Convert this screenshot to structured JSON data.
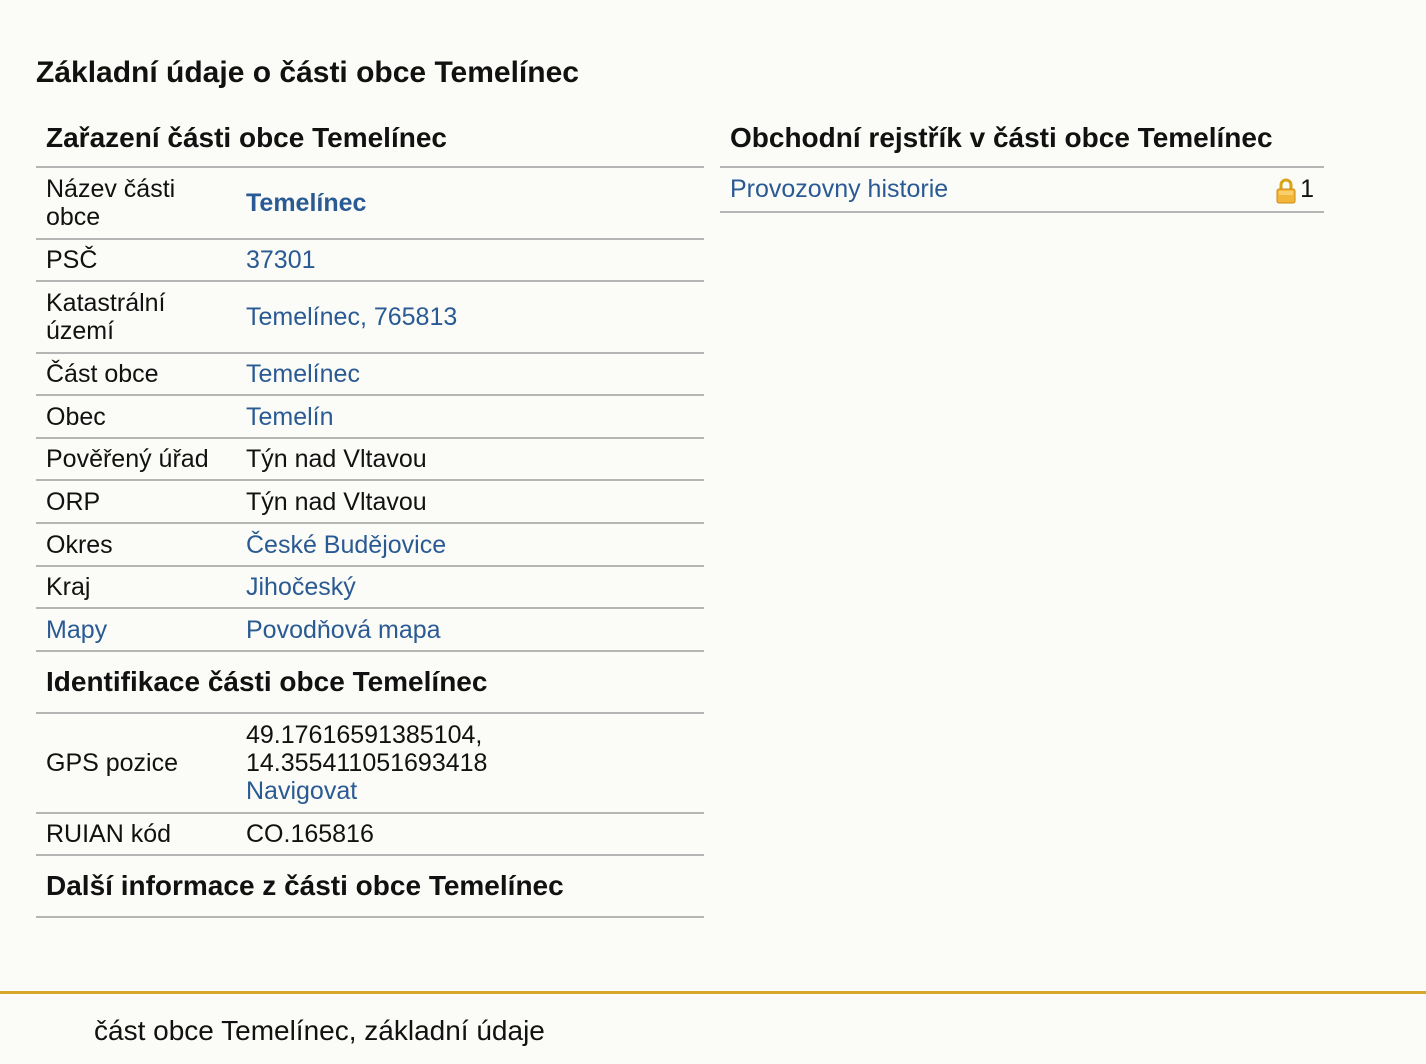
{
  "page": {
    "title": "Základní údaje o části obce Temelínec"
  },
  "zarazeni": {
    "heading": "Zařazení části obce Temelínec",
    "rows": [
      {
        "label": "Název části obce",
        "value": "Temelínec"
      },
      {
        "label": "PSČ",
        "value": "37301"
      },
      {
        "label": "Katastrální území",
        "value": "Temelínec, 765813"
      },
      {
        "label": "Část obce",
        "value": "Temelínec"
      },
      {
        "label": "Obec",
        "value": "Temelín"
      },
      {
        "label": "Pověřený úřad",
        "value": "Týn nad Vltavou"
      },
      {
        "label": "ORP",
        "value": "Týn nad Vltavou"
      },
      {
        "label": "Okres",
        "value": "České Budějovice"
      },
      {
        "label": "Kraj",
        "value": "Jihočeský"
      },
      {
        "label": "Mapy",
        "value": "Povodňová mapa"
      }
    ]
  },
  "identifikace": {
    "heading": "Identifikace části obce Temelínec",
    "gps_label": "GPS pozice",
    "gps_lat": "49.17616591385104,",
    "gps_lon": "14.355411051693418",
    "navigate_label": "Navigovat",
    "ruian_label": "RUIAN kód",
    "ruian_value": "CO.165816"
  },
  "dalsi": {
    "heading": "Další informace z části obce Temelínec"
  },
  "rejstrik": {
    "heading": "Obchodní rejstřík v části obce Temelínec",
    "item_label": "Provozovny historie",
    "item_count": "1",
    "lock_icon": "padlock-icon"
  },
  "footer": {
    "text": "část obce Temelínec, základní údaje",
    "line_color": "#d7a72b"
  },
  "colors": {
    "link": "#2a5a93",
    "background": "#fbfbf7",
    "border": "#b5b5b5"
  }
}
